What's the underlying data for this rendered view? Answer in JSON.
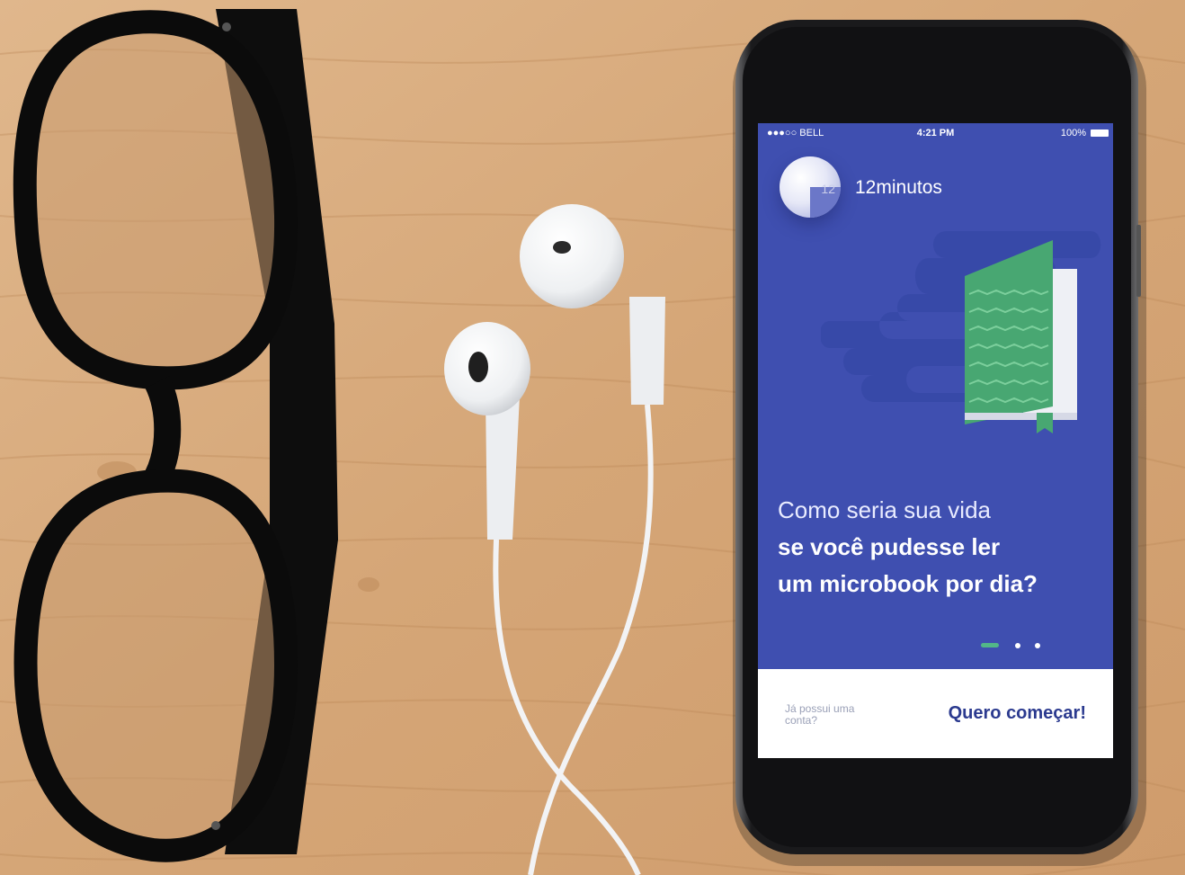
{
  "status_bar": {
    "carrier": "●●●○○ BELL",
    "time": "4:21 PM",
    "battery": "100%"
  },
  "app": {
    "logo_number": "12",
    "brand_name": "12minutos"
  },
  "onboarding": {
    "headline_light": "Como seria sua vida",
    "headline_bold_line1": "se você pudesse ler",
    "headline_bold_line2": "um microbook por dia?",
    "page_indicator": {
      "current": 1,
      "total": 3
    }
  },
  "footer": {
    "login_label": "Já possui uma conta?",
    "start_label": "Quero começar!"
  },
  "colors": {
    "screen_bg": "#3f4fb0",
    "accent_green": "#52b788",
    "cta_text": "#2b3a8f",
    "wood": "#d9ab7e"
  }
}
